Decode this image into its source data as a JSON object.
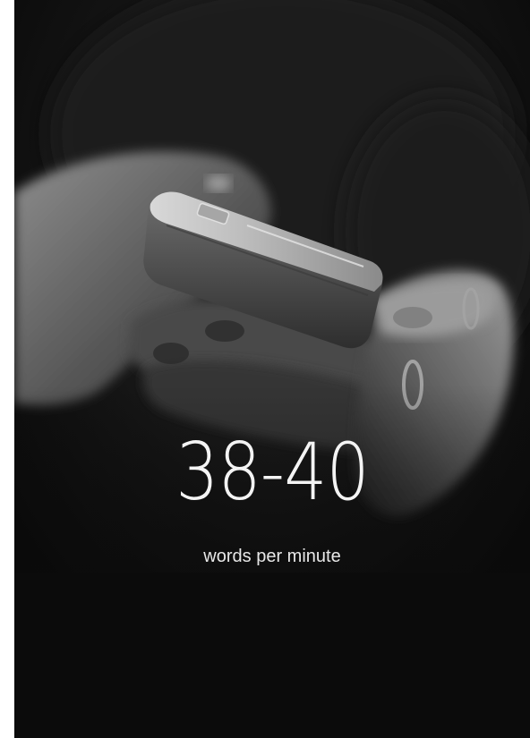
{
  "stat": {
    "value": "38-40",
    "label": "words per minute"
  },
  "colors": {
    "background": "#0b0b0b",
    "text": "#f4f4f4"
  }
}
